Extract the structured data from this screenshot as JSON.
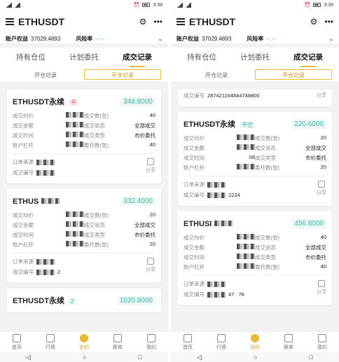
{
  "status": {
    "time": "3:39"
  },
  "header": {
    "title": "ETHUSDT"
  },
  "account": {
    "equity_label": "账户权益",
    "equity_value": "37029.4893",
    "risk_label": "风险率",
    "risk_value": "--.--"
  },
  "tabs": [
    "持有仓位",
    "计划委托",
    "成交记录"
  ],
  "segments": [
    "开仓记录",
    "平仓记录"
  ],
  "fields": {
    "avg_price": "成交均价",
    "amount": "成交金额",
    "time": "成交时间",
    "leverage": "账户杠杆",
    "qty": "成交数(张)",
    "state": "成交状态",
    "type": "成交类型",
    "order_qty": "委托数(张)",
    "source": "订单来源",
    "order_no": "成交编号",
    "share": "分享"
  },
  "left_cards": [
    {
      "symbol": "ETHUSDT永续",
      "tag": "平",
      "price": "348.8000",
      "qty": "40",
      "state": "全部成交",
      "type": "市价委托",
      "order_qty": "40"
    },
    {
      "symbol": "ETHUS",
      "tag": "",
      "price": "332.4000",
      "qty": "20",
      "state": "全部成交",
      "type": "市价委托",
      "order_qty": "20",
      "order_no_tail": "2"
    },
    {
      "symbol": "ETHUSDT永续",
      "tag": "2",
      "price": "1020.8000"
    }
  ],
  "right_cards": [
    {
      "order_no": "287421164844748800"
    },
    {
      "symbol": "ETHUSDT永续",
      "tag": "平空",
      "price": "220.6000",
      "time_prefix": "08",
      "qty": "20",
      "state": "全部成交",
      "type": "市价委托",
      "order_qty": "20",
      "order_no_tail": "2224"
    },
    {
      "symbol": "ETHUSI",
      "price": "456.8000",
      "qty": "40",
      "state": "全部成交",
      "type": "市价委托",
      "order_qty": "40",
      "order_no_mid": "47",
      "order_no_tail": "76"
    }
  ],
  "nav": [
    "首页",
    "行情",
    "合约",
    "跟单",
    "我的"
  ],
  "colors": {
    "accent": "#e8b931",
    "green": "#3bb3a3",
    "red": "#e24b4b"
  }
}
